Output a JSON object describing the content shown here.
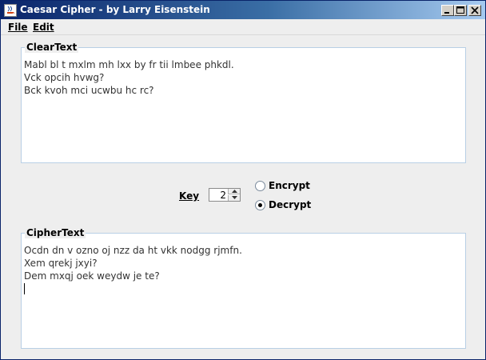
{
  "window": {
    "title": "Caesar Cipher - by Larry Eisenstein"
  },
  "menu": {
    "file_label": "File",
    "edit_label": "Edit"
  },
  "cleartext": {
    "legend": "ClearText",
    "content": "Mabl bl t mxlm mh lxx by fr tii lmbee phkdl.\nVck opcih hvwg?\nBck kvoh mci ucwbu hc rc?"
  },
  "key": {
    "label": "Key",
    "value": "2"
  },
  "mode": {
    "encrypt_label": "Encrypt",
    "decrypt_label": "Decrypt",
    "selected": "Decrypt"
  },
  "ciphertext": {
    "legend": "CipherText",
    "content": "Ocdn dn v ozno oj nzz da ht vkk nodgg rjmfn.\nXem qrekj jxyi?\nDem mxqj oek weydw je te?\n"
  }
}
